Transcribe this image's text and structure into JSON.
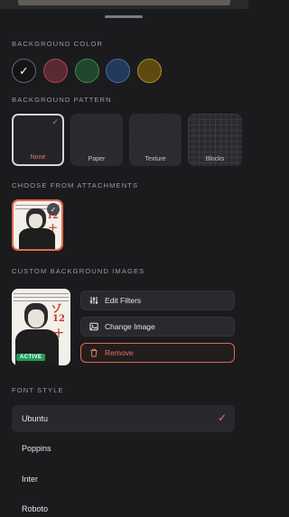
{
  "colors": {
    "accent": "#e27a5e",
    "active_badge": "#1f9e58",
    "background": "#1b1b1e"
  },
  "background_color": {
    "label": "Background Color",
    "swatches": [
      {
        "name": "black",
        "color": "#151517",
        "selected": true
      },
      {
        "name": "red",
        "color": "#5a2a33",
        "selected": false
      },
      {
        "name": "green",
        "color": "#22462b",
        "selected": false
      },
      {
        "name": "blue",
        "color": "#233a5c",
        "selected": false
      },
      {
        "name": "gold",
        "color": "#5c4a12",
        "selected": false
      }
    ]
  },
  "background_pattern": {
    "label": "Background Pattern",
    "options": [
      {
        "label": "None",
        "selected": true
      },
      {
        "label": "Paper",
        "selected": false
      },
      {
        "label": "Texture",
        "selected": false
      },
      {
        "label": "Blocks",
        "selected": false
      }
    ]
  },
  "attachments": {
    "label": "Choose From Attachments"
  },
  "custom_images": {
    "label": "Custom Background Images",
    "active_badge": "ACTIVE",
    "edit_filters": "Edit Filters",
    "change_image": "Change Image",
    "remove": "Remove",
    "edit_icon": "sliders-icon",
    "change_icon": "image-icon",
    "remove_icon": "trash-icon"
  },
  "font_style": {
    "label": "Font Style",
    "fonts": [
      {
        "label": "Ubuntu",
        "selected": true
      },
      {
        "label": "Poppins",
        "selected": false
      },
      {
        "label": "Inter",
        "selected": false
      },
      {
        "label": "Roboto",
        "selected": false
      }
    ]
  }
}
